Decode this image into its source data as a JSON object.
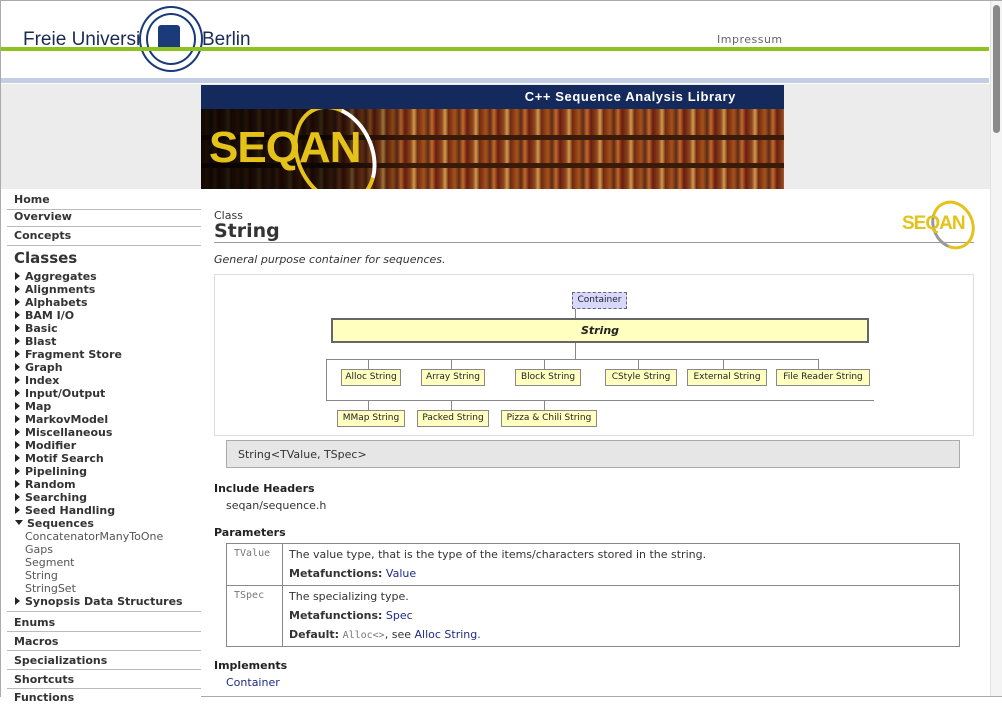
{
  "header": {
    "university_left": "Freie Universität",
    "university_right": "Berlin",
    "impressum": "Impressum"
  },
  "banner": {
    "title": "C++ Sequence Analysis Library",
    "logo_text": "SEQAN"
  },
  "sidebar": {
    "top_items": [
      {
        "label": "Home"
      },
      {
        "label": "Overview"
      },
      {
        "label": "Concepts"
      }
    ],
    "classes_heading": "Classes",
    "classes": [
      {
        "label": "Aggregates"
      },
      {
        "label": "Alignments"
      },
      {
        "label": "Alphabets"
      },
      {
        "label": "BAM I/O"
      },
      {
        "label": "Basic"
      },
      {
        "label": "Blast"
      },
      {
        "label": "Fragment Store"
      },
      {
        "label": "Graph"
      },
      {
        "label": "Index"
      },
      {
        "label": "Input/Output"
      },
      {
        "label": "Map"
      },
      {
        "label": "MarkovModel"
      },
      {
        "label": "Miscellaneous"
      },
      {
        "label": "Modifier"
      },
      {
        "label": "Motif Search"
      },
      {
        "label": "Pipelining"
      },
      {
        "label": "Random"
      },
      {
        "label": "Searching"
      },
      {
        "label": "Seed Handling"
      },
      {
        "label": "Sequences"
      },
      {
        "label": "Synopsis Data Structures"
      }
    ],
    "sequences_children": [
      "ConcatenatorManyToOne",
      "Gaps",
      "Segment",
      "String",
      "StringSet"
    ],
    "bottom_items": [
      {
        "label": "Enums"
      },
      {
        "label": "Macros"
      },
      {
        "label": "Specializations"
      },
      {
        "label": "Shortcuts"
      },
      {
        "label": "Functions"
      }
    ]
  },
  "page": {
    "kind": "Class",
    "name": "String",
    "logo_text": "SEQAN",
    "description": "General purpose container for sequences.",
    "signature": "String<TValue, TSpec>"
  },
  "diagram": {
    "parent": "Container",
    "main": "String",
    "children_row1": [
      "Alloc String",
      "Array String",
      "Block String",
      "CStyle String",
      "External String",
      "File Reader String"
    ],
    "children_row2": [
      "MMap String",
      "Packed String",
      "Pizza & Chili String"
    ]
  },
  "include": {
    "title": "Include Headers",
    "file": "seqan/sequence.h"
  },
  "parameters": {
    "title": "Parameters",
    "rows": [
      {
        "name": "TValue",
        "text": "The value type, that is the type of the items/characters stored in the string.",
        "metafunctions_label": "Metafunctions:",
        "metafunctions_link": "Value"
      },
      {
        "name": "TSpec",
        "text": "The specializing type.",
        "metafunctions_label": "Metafunctions:",
        "metafunctions_link": "Spec",
        "default_label": "Default:",
        "default_code": "Alloc<>",
        "default_see": ", see",
        "default_link": "Alloc String."
      }
    ]
  },
  "implements": {
    "title": "Implements",
    "link": "Container"
  },
  "colors": {
    "navy": "#142a5c",
    "green": "#8dc21f",
    "logo_yellow": "#e5c21a",
    "box_yellow": "#ffffc0",
    "link": "#1f2a88"
  }
}
